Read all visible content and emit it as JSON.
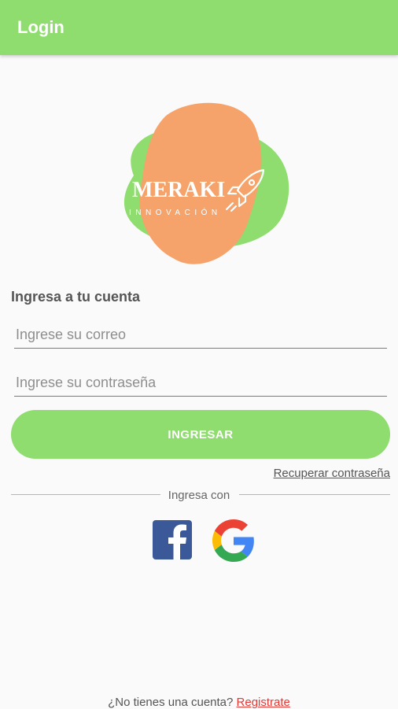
{
  "appbar": {
    "title": "Login",
    "color": "#8fdc6f"
  },
  "logo": {
    "brand": "MERAKI",
    "tagline": "INNOVACIÓN",
    "icon": "rocket-icon"
  },
  "form": {
    "heading": "Ingresa a tu cuenta",
    "email_placeholder": "Ingrese su correo",
    "password_placeholder": "Ingrese su contraseña",
    "submit_label": "INGRESAR",
    "recover_link": "Recuperar contraseña"
  },
  "social": {
    "divider_text": "Ingresa con",
    "providers": [
      {
        "name": "facebook",
        "icon": "facebook-icon",
        "color": "#3b5998"
      },
      {
        "name": "google",
        "icon": "google-icon"
      }
    ]
  },
  "footer": {
    "question": "¿No tienes una cuenta?",
    "register_link": "Registrate",
    "link_color": "#e53935"
  }
}
